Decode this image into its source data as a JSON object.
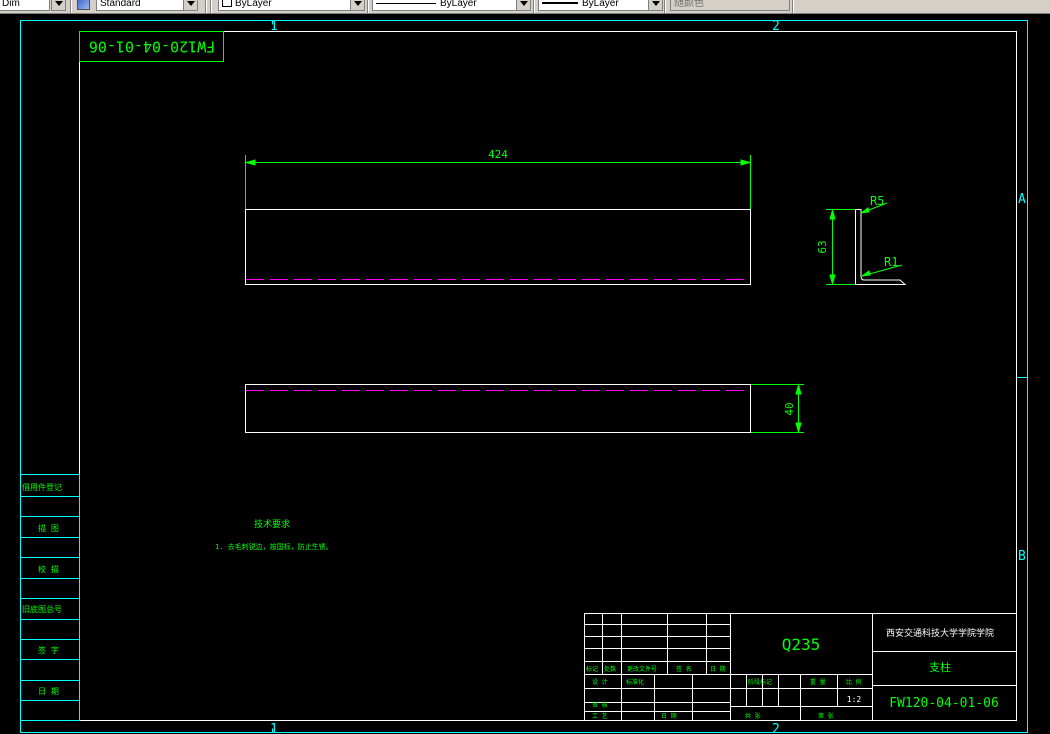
{
  "toolbar": {
    "dimstyle_value": "Dim",
    "textstyle_value": "Standard",
    "layer_value": "ByLayer",
    "linetype_value": "ByLayer",
    "lineweight_value": "ByLayer",
    "plotstyle_value": "随颜色"
  },
  "colors": {
    "frame": "#00ffff",
    "geometry": "#ffffff",
    "dimension": "#00ff00",
    "hidden_line": "#ff00ff",
    "title_text": "#00ff00"
  },
  "border": {
    "zones_top": [
      "1",
      "2"
    ],
    "zones_bottom": [
      "1",
      "2"
    ],
    "zones_right": [
      "A",
      "B"
    ]
  },
  "drawing": {
    "rotated_number": "FW120-04-01-06",
    "dim_length": "424",
    "dim_height": "63",
    "dim_width": "40",
    "radius_outer": "R5",
    "radius_inner": "R1",
    "tech_req_title": "技术要求",
    "tech_req_item": "1. 去毛刺锐边，按国标，防止生锈。"
  },
  "side_block": {
    "labels": [
      "借用件登记",
      "描 图",
      "校 描",
      "旧底图总号",
      "签 字",
      "日 期"
    ]
  },
  "title_block": {
    "material": "Q235",
    "school": "西安交通科技大学学院学院",
    "part_name": "支柱",
    "drawing_number": "FW120-04-01-06",
    "scale": "1:2",
    "rev_labels": [
      "标记",
      "处数",
      "更改文件号",
      "签 名",
      "日 期"
    ],
    "row_labels": [
      "设 计",
      "标准化",
      "阶段标记",
      "重 量",
      "比 例",
      "审 核",
      "工 艺",
      "日 期",
      "共 张",
      "第 张"
    ]
  }
}
